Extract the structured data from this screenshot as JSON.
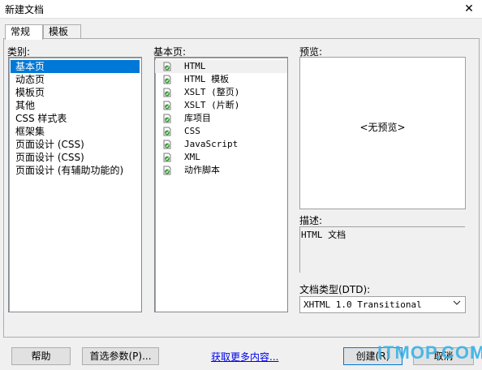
{
  "window": {
    "title": "新建文档",
    "close_glyph": "✕"
  },
  "tabs": [
    {
      "label": "常规",
      "active": true
    },
    {
      "label": "模板",
      "active": false
    }
  ],
  "category": {
    "label": "类别:",
    "items": [
      {
        "label": "基本页",
        "selected": true
      },
      {
        "label": "动态页"
      },
      {
        "label": "模板页"
      },
      {
        "label": "其他"
      },
      {
        "label": "CSS 样式表"
      },
      {
        "label": "框架集"
      },
      {
        "label": "页面设计 (CSS)"
      },
      {
        "label": "页面设计 (CSS)"
      },
      {
        "label": "页面设计 (有辅助功能的)"
      }
    ]
  },
  "basic_page": {
    "label": "基本页:",
    "items": [
      {
        "label": "HTML",
        "selected": true,
        "icon": "file-icon"
      },
      {
        "label": "HTML 模板",
        "icon": "file-icon"
      },
      {
        "label": "XSLT (整页)",
        "icon": "file-icon"
      },
      {
        "label": "XSLT (片断)",
        "icon": "file-icon"
      },
      {
        "label": "库项目",
        "icon": "file-icon"
      },
      {
        "label": "CSS",
        "icon": "file-icon"
      },
      {
        "label": "JavaScript",
        "icon": "file-icon"
      },
      {
        "label": "XML",
        "icon": "file-icon"
      },
      {
        "label": "动作脚本",
        "icon": "file-icon"
      }
    ]
  },
  "preview": {
    "label": "预览:",
    "placeholder": "<无预览>"
  },
  "description": {
    "label": "描述:",
    "text": "HTML 文档"
  },
  "doctype": {
    "label": "文档类型(DTD):",
    "value": "XHTML 1.0 Transitional"
  },
  "buttons": {
    "help": "帮助",
    "preferences": "首选参数(P)...",
    "more_content": "获取更多内容...",
    "create": "创建(R)",
    "cancel": "取消"
  },
  "watermark": "ITMOP.COM",
  "colors": {
    "selection": "#0078d7",
    "icon_green": "#3a9b3a",
    "link": "#0000ee",
    "watermark": "#3cb4e6"
  }
}
